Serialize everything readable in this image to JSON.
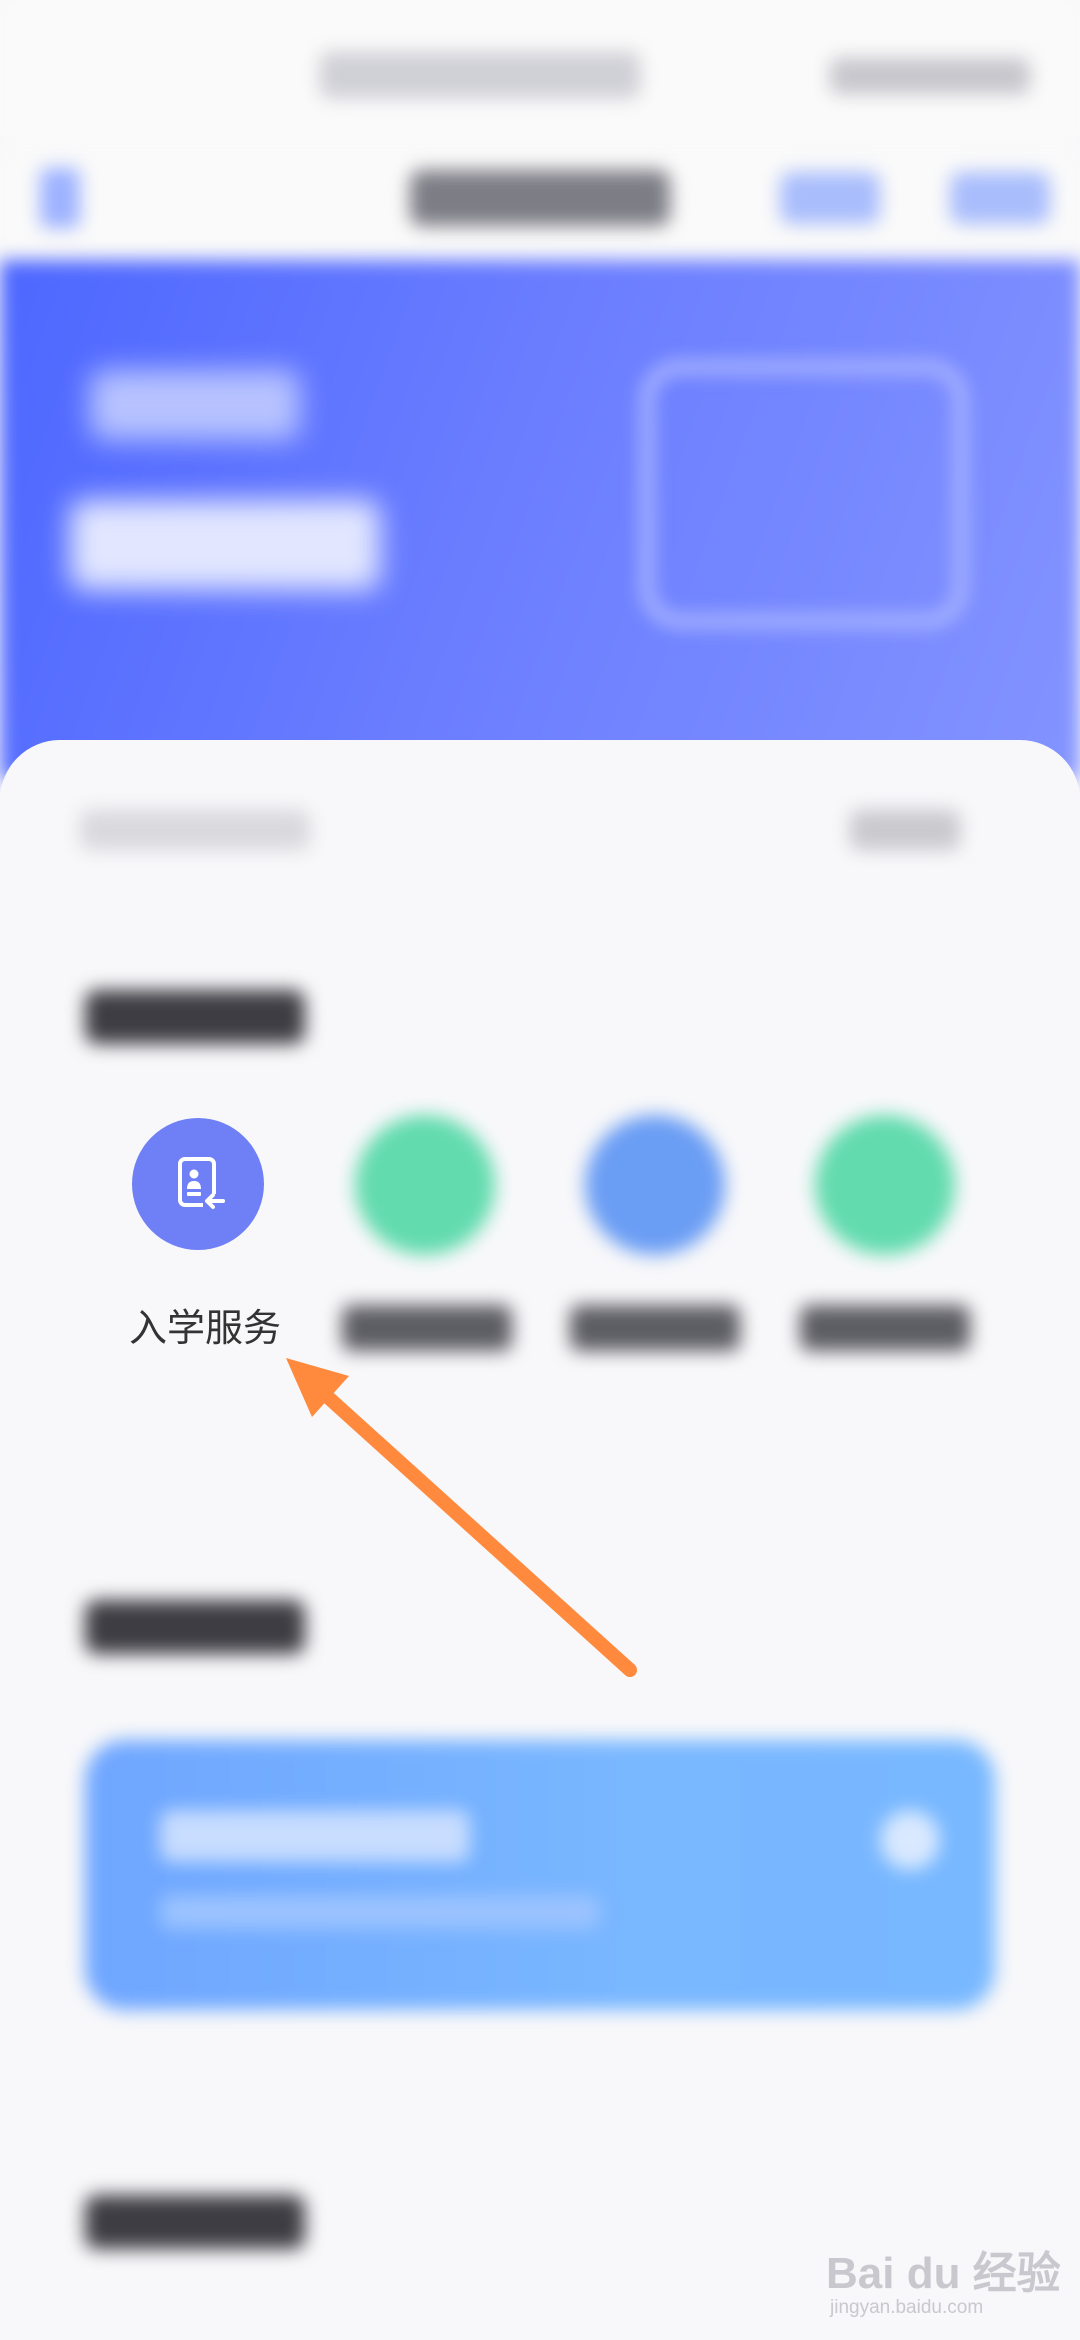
{
  "services": {
    "main_label": "入学服务"
  },
  "colors": {
    "banner": "#5a6ffd",
    "service_icon": "#6f80f7",
    "green_icon": "#62dbae",
    "blue_icon": "#6a9df4",
    "panel": "#78b4ff",
    "arrow": "#ff8a3d"
  },
  "icons": {
    "main_service_icon": "document-person-return-icon"
  },
  "watermark": {
    "brand": "Bai du 经验",
    "url": "jingyan.baidu.com"
  }
}
